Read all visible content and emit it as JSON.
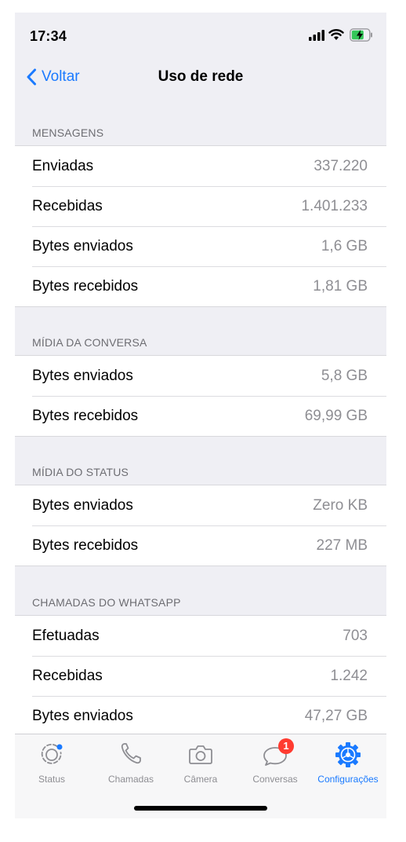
{
  "status_bar": {
    "time": "17:34"
  },
  "nav": {
    "back_label": "Voltar",
    "title": "Uso de rede"
  },
  "sections": [
    {
      "header": "MENSAGENS",
      "rows": [
        {
          "label": "Enviadas",
          "value": "337.220"
        },
        {
          "label": "Recebidas",
          "value": "1.401.233"
        },
        {
          "label": "Bytes enviados",
          "value": "1,6 GB"
        },
        {
          "label": "Bytes recebidos",
          "value": "1,81 GB"
        }
      ]
    },
    {
      "header": "MÍDIA DA CONVERSA",
      "rows": [
        {
          "label": "Bytes enviados",
          "value": "5,8 GB"
        },
        {
          "label": "Bytes recebidos",
          "value": "69,99 GB"
        }
      ]
    },
    {
      "header": "MÍDIA DO STATUS",
      "rows": [
        {
          "label": "Bytes enviados",
          "value": "Zero KB"
        },
        {
          "label": "Bytes recebidos",
          "value": "227 MB"
        }
      ]
    },
    {
      "header": "CHAMADAS DO WHATSAPP",
      "rows": [
        {
          "label": "Efetuadas",
          "value": "703"
        },
        {
          "label": "Recebidas",
          "value": "1.242"
        },
        {
          "label": "Bytes enviados",
          "value": "47,27 GB"
        }
      ]
    }
  ],
  "tabbar": {
    "tabs": [
      {
        "label": "Status",
        "icon": "status-icon"
      },
      {
        "label": "Chamadas",
        "icon": "phone-icon"
      },
      {
        "label": "Câmera",
        "icon": "camera-icon"
      },
      {
        "label": "Conversas",
        "icon": "chat-bubble-icon",
        "badge": "1"
      },
      {
        "label": "Configurações",
        "icon": "gear-icon",
        "active": true
      }
    ]
  },
  "colors": {
    "accent": "#1a7aff",
    "background": "#efeff4",
    "secondary_text": "#8e8e93",
    "badge": "#ff3b30"
  }
}
